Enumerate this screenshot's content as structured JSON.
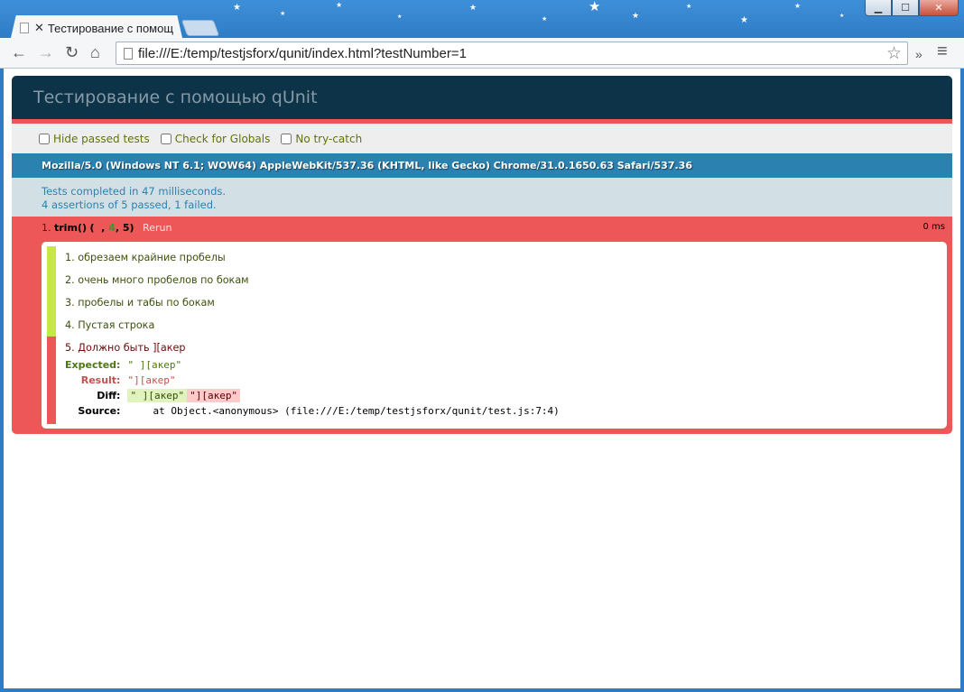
{
  "window": {
    "tab_title": "Тестирование с помощ",
    "controls": {
      "minimize": "▁",
      "maximize": "☐",
      "close": "✕"
    }
  },
  "toolbar": {
    "back_icon": "←",
    "forward_icon": "→",
    "reload_icon": "↻",
    "home_icon": "⌂",
    "url": "file:///E:/temp/testjsforx/qunit/index.html?testNumber=1",
    "bookmark_icon": "☆",
    "extensions_icon": "»",
    "menu_icon": "≡"
  },
  "qunit": {
    "header": "Тестирование с помощью qUnit",
    "filters": {
      "hide_passed": "Hide passed tests",
      "check_globals": "Check for Globals",
      "no_try_catch": "No try-catch"
    },
    "user_agent": "Mozilla/5.0 (Windows NT 6.1; WOW64) AppleWebKit/537.36 (KHTML, like Gecko) Chrome/31.0.1650.63 Safari/537.36",
    "result": {
      "line1": "Tests completed in 47 milliseconds.",
      "line2": "4 assertions of 5 passed, 1 failed."
    },
    "test": {
      "number": "1.",
      "name": "trim()",
      "failed": "1",
      "passed": "4",
      "total": "5",
      "rerun": "Rerun",
      "runtime": "0 ms",
      "assertions": [
        "1. обрезаем крайние пробелы",
        "2. очень много пробелов по бокам",
        "3. пробелы и табы по бокам",
        "4. Пустая строка"
      ],
      "failed_assertion": {
        "message": "5. Должно быть ][акер",
        "expected_label": "Expected:",
        "expected": "\" ][акер\"",
        "result_label": "Result:",
        "result": "\"][акер\"",
        "diff_label": "Diff:",
        "diff_del": "\" ][акер\"",
        "diff_ins": "\"][акер\"",
        "source_label": "Source:",
        "source": "at Object.<anonymous> (file:///E:/temp/testjsforx/qunit/test.js:7:4)"
      }
    }
  },
  "colors": {
    "header_bg": "#0d3349",
    "fail_red": "#ee5757",
    "pass_green": "#c6e746",
    "ua_blue": "#2b81af",
    "result_bg": "#d2e0e6"
  }
}
